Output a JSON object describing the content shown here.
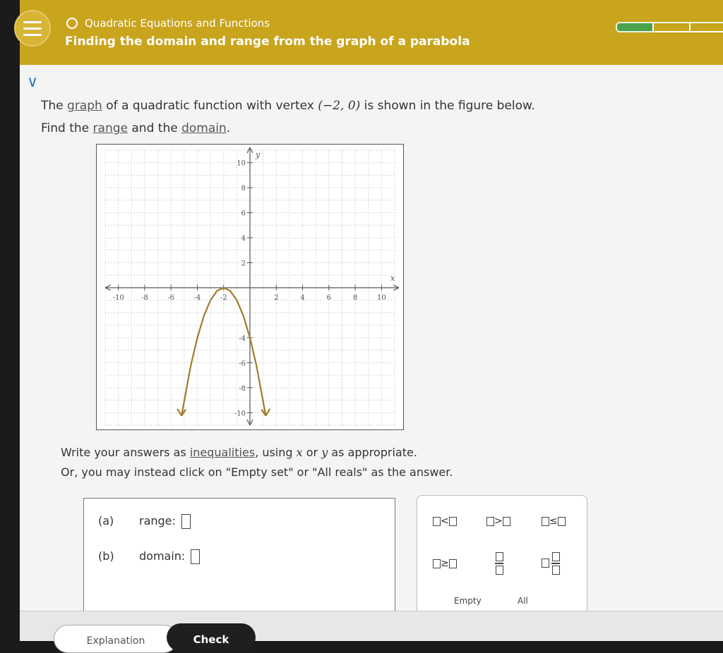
{
  "header": {
    "topic": "Quadratic Equations and Functions",
    "title": "Finding the domain and range from the graph of a parabola",
    "progress_segments_filled": 1,
    "progress_segments_total": 3,
    "accent_color": "#c9a41d",
    "progress_color": "#4aa34b"
  },
  "question": {
    "part1": "The ",
    "graph_link": "graph",
    "part2": " of a quadratic function with vertex ",
    "vertex": "(−2, 0)",
    "part3": " is shown in the figure below.",
    "line2_a": "Find the ",
    "range_link": "range",
    "line2_b": " and the ",
    "domain_link": "domain",
    "line2_c": "."
  },
  "chart_data": {
    "type": "line",
    "series": [
      {
        "x": [
          -5.2,
          -4.5,
          -4,
          -3.5,
          -3,
          -2.5,
          -2,
          -1.5,
          -1,
          -0.5,
          0,
          0.5,
          1.2
        ],
        "y": [
          -10.24,
          -6.25,
          -4,
          -2.25,
          -1,
          -0.25,
          0,
          -0.25,
          -1,
          -2.25,
          -4,
          -6.25,
          -10.24
        ]
      }
    ],
    "xlim": [
      -11,
      11
    ],
    "ylim": [
      -11,
      11
    ],
    "x_ticks": [
      -10,
      -8,
      -6,
      -4,
      -2,
      2,
      4,
      6,
      8,
      10
    ],
    "y_ticks": [
      10,
      8,
      6,
      4,
      2,
      -4,
      -6,
      -8,
      -10
    ],
    "xlabel": "x",
    "ylabel": "y",
    "grid": true,
    "curve_color": "#a07c2a"
  },
  "instructions": {
    "line1_a": "Write your answers as ",
    "inequalities_link": "inequalities",
    "line1_b": ", using ",
    "var_x": "x",
    "line1_c": " or ",
    "var_y": "y",
    "line1_d": " as appropriate.",
    "line2": "Or, you may instead click on \"Empty set\" or \"All reals\" as the answer."
  },
  "answers": {
    "a_letter": "(a)",
    "a_label": "range:",
    "b_letter": "(b)",
    "b_label": "domain:"
  },
  "keypad": {
    "lt": "<",
    "gt": ">",
    "le": "≤",
    "ge": "≥",
    "empty": "Empty",
    "all": "All"
  },
  "buttons": {
    "explanation": "Explanation",
    "check": "Check"
  }
}
